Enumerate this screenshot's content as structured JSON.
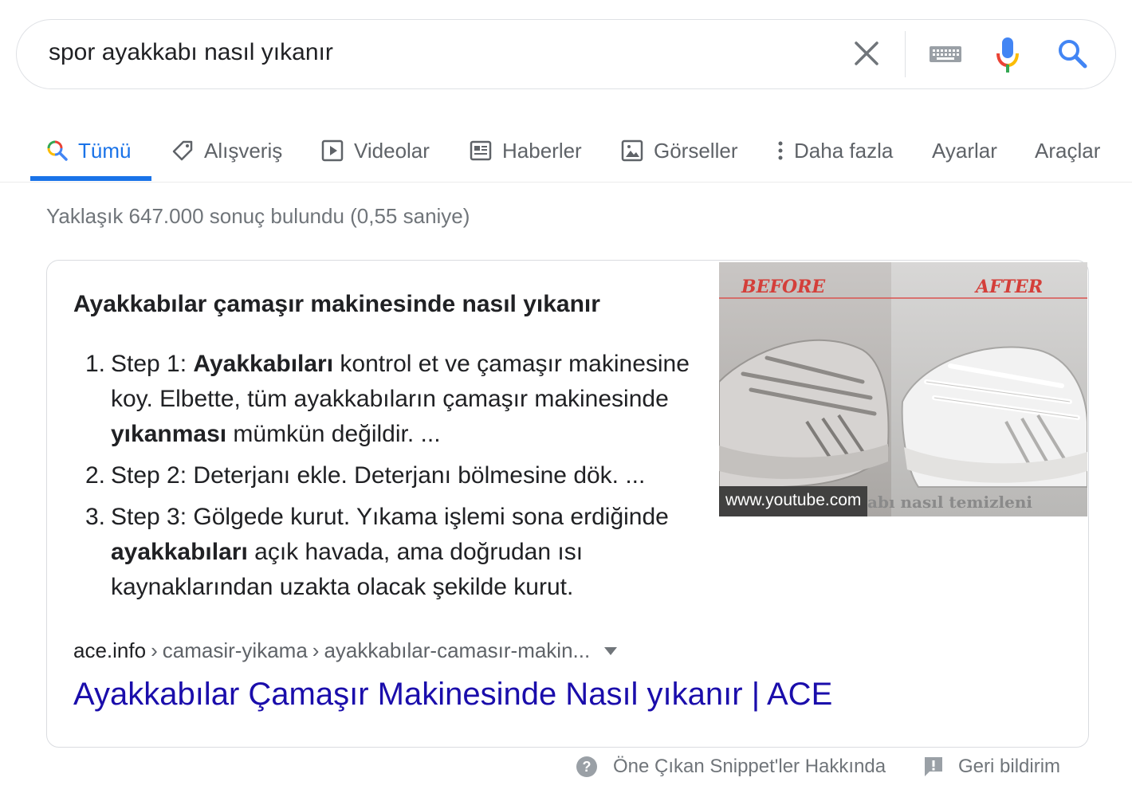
{
  "search": {
    "query": "spor ayakkabı nasıl yıkanır",
    "icons": {
      "clear": "close-icon",
      "keyboard": "keyboard-icon",
      "voice": "mic-icon",
      "search": "search-icon"
    }
  },
  "tabs": [
    {
      "label": "Tümü",
      "icon": "search-icon",
      "active": true
    },
    {
      "label": "Alışveriş",
      "icon": "tag-icon"
    },
    {
      "label": "Videolar",
      "icon": "play-icon"
    },
    {
      "label": "Haberler",
      "icon": "news-icon"
    },
    {
      "label": "Görseller",
      "icon": "image-icon"
    },
    {
      "label": "Daha fazla",
      "icon": "more-vert-icon"
    },
    {
      "label": "Ayarlar"
    },
    {
      "label": "Araçlar"
    }
  ],
  "result_stats": "Yaklaşık 647.000 sonuç bulundu (0,55 saniye)",
  "snippet": {
    "title": "Ayakkabılar çamaşır makinesinde nasıl yıkanır",
    "steps": [
      {
        "num": "1.",
        "parts": [
          "Step 1: ",
          "Ayakkabıları",
          " kontrol et ve çamaşır makinesine koy. Elbette, tüm ayakkabıların çamaşır makinesinde ",
          "yıkanması",
          " mümkün değildir. ..."
        ]
      },
      {
        "num": "2.",
        "parts": [
          "Step 2: Deterjanı ekle. Deterjanı bölmesine dök. ..."
        ]
      },
      {
        "num": "3.",
        "parts": [
          "Step 3: Gölgede kurut. Yıkama işlemi sona erdiğinde ",
          "ayakkabıları",
          " açık havada, ama doğrudan ısı kaynaklarından uzakta olacak şekilde kurut."
        ]
      }
    ],
    "image": {
      "before_label": "BEFORE",
      "after_label": "AFTER",
      "source": "www.youtube.com",
      "overlay_fragment": "abı nasıl temizleni"
    },
    "breadcrumb": {
      "site": "ace.info",
      "path": [
        "camasir-yikama",
        "ayakkabılar-camasır-makin..."
      ]
    },
    "link_title": "Ayakkabılar Çamaşır Makinesinde Nasıl yıkanır | ACE"
  },
  "footer": {
    "about": "Öne Çıkan Snippet'ler Hakkında",
    "feedback": "Geri bildirim"
  },
  "colors": {
    "accent": "#1a73e8",
    "link": "#1a0dab",
    "muted": "#70757a"
  }
}
